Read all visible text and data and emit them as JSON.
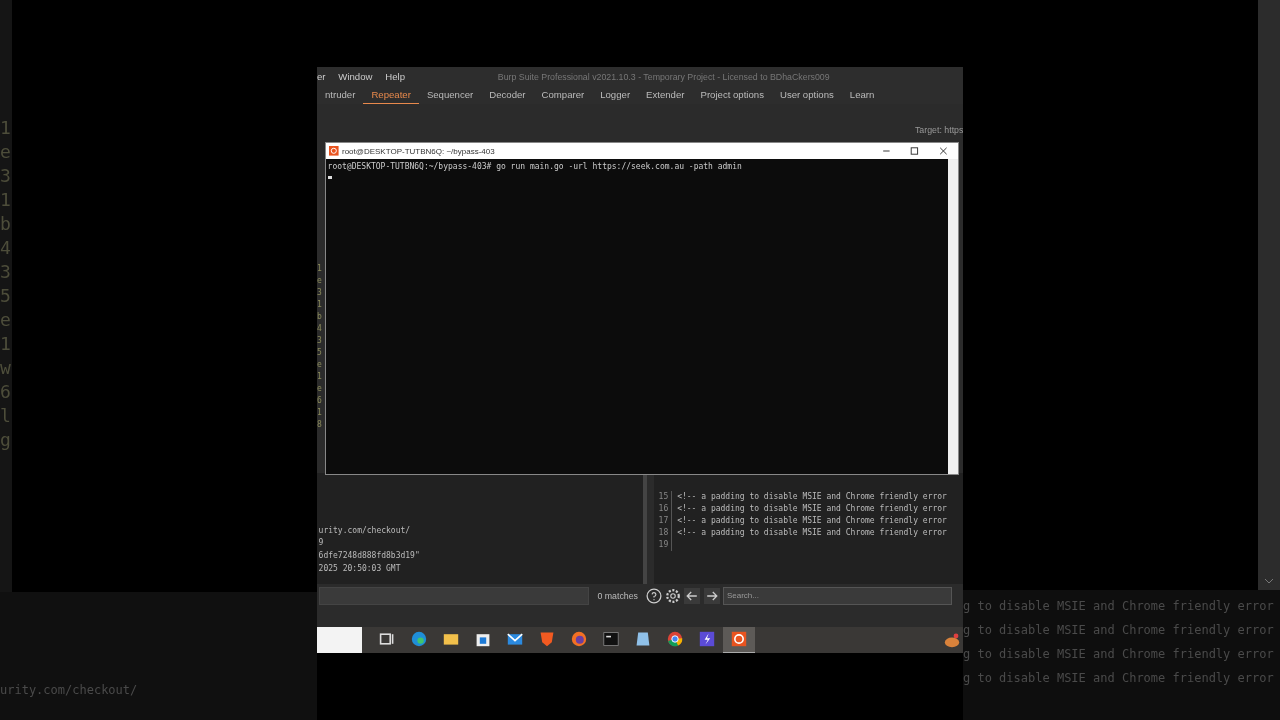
{
  "backdrop_left": {
    "gutter": [
      "1",
      "e",
      "3",
      "1",
      "b",
      "4",
      "3",
      "5",
      "e",
      "1",
      "w",
      "6",
      "l",
      "g"
    ],
    "url_line": "urity.com/checkout/"
  },
  "backdrop_right": {
    "lines": [
      "g to disable MSIE and Chrome friendly error",
      "g to disable MSIE and Chrome friendly error",
      "g to disable MSIE and Chrome friendly error",
      "g to disable MSIE and Chrome friendly error"
    ]
  },
  "menu": [
    "er",
    "Window",
    "Help"
  ],
  "window": {
    "title": "Burp Suite Professional v2021.10.3 - Temporary Project - Licensed to BDhaCkers009"
  },
  "tabs": [
    {
      "label": "ntruder",
      "selected": false
    },
    {
      "label": "Repeater",
      "selected": true
    },
    {
      "label": "Sequencer",
      "selected": false
    },
    {
      "label": "Decoder",
      "selected": false
    },
    {
      "label": "Comparer",
      "selected": false
    },
    {
      "label": "Logger",
      "selected": false
    },
    {
      "label": "Extender",
      "selected": false
    },
    {
      "label": "Project options",
      "selected": false
    },
    {
      "label": "User options",
      "selected": false
    },
    {
      "label": "Learn",
      "selected": false
    }
  ],
  "target_label": "Target: https",
  "gutter": [
    "1",
    "e",
    "3",
    "1",
    "b",
    "4",
    "3",
    "5",
    "e",
    "1",
    "e",
    "6",
    "1",
    "8"
  ],
  "terminal": {
    "title": "root@DESKTOP-TUTBN6Q: ~/bypass-403",
    "prompt": "root@DESKTOP-TUTBN6Q:~/bypass-403# go run main.go -url https://seek.com.au -path admin"
  },
  "request_lines": [
    "urity.com/checkout/",
    "9",
    "6dfe7248d888fd8b3d19\"",
    "2025 20:50:03 GMT"
  ],
  "response_lines": [
    {
      "number": "15",
      "text": "<!-- a padding to disable MSIE and Chrome friendly error"
    },
    {
      "number": "16",
      "text": "<!-- a padding to disable MSIE and Chrome friendly error"
    },
    {
      "number": "17",
      "text": "<!-- a padding to disable MSIE and Chrome friendly error"
    },
    {
      "number": "18",
      "text": "<!-- a padding to disable MSIE and Chrome friendly error"
    },
    {
      "number": "19"
    }
  ],
  "search_bar": {
    "matches": "0 matches",
    "placeholder": "Search..."
  },
  "taskbar": [
    {
      "kind": "taskview",
      "selected": false
    },
    {
      "kind": "edge",
      "selected": false
    },
    {
      "kind": "folder",
      "selected": false
    },
    {
      "kind": "store",
      "selected": false
    },
    {
      "kind": "mail",
      "selected": false
    },
    {
      "kind": "shield",
      "selected": false
    },
    {
      "kind": "fox",
      "selected": false
    },
    {
      "kind": "terminal",
      "selected": false
    },
    {
      "kind": "notepad",
      "selected": false
    },
    {
      "kind": "chrome",
      "selected": false
    },
    {
      "kind": "purple",
      "selected": false
    },
    {
      "kind": "ubuntu",
      "selected": true
    }
  ]
}
